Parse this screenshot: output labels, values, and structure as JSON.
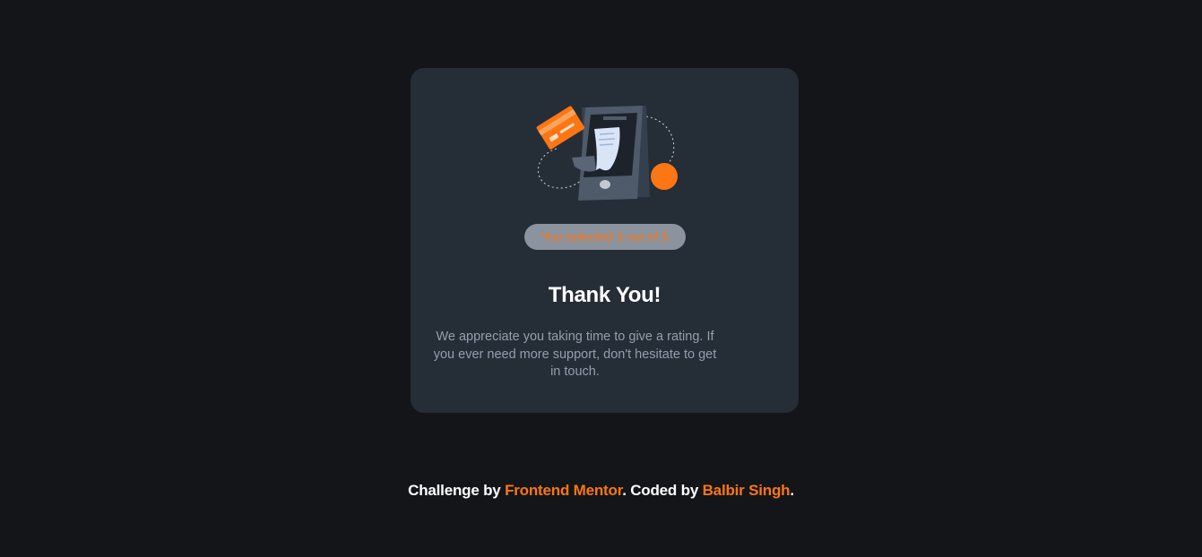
{
  "card": {
    "selection_text": "You selected 3 out of 5",
    "title": "Thank You!",
    "message": "We appreciate you taking time to give a rating. If you ever need more support, don't hesitate to get in touch.",
    "illustration_icon": "payment-phone-illustration"
  },
  "footer": {
    "challenge_prefix": "Challenge by ",
    "challenge_link": "Frontend Mentor",
    "coded_prefix": ". Coded by ",
    "author_link": "Balbir Singh",
    "suffix": "."
  },
  "colors": {
    "page_bg": "#131518",
    "card_bg": "#252d37",
    "accent": "#fc7614",
    "badge_bg": "#8b939e",
    "muted_text": "#959eac"
  }
}
